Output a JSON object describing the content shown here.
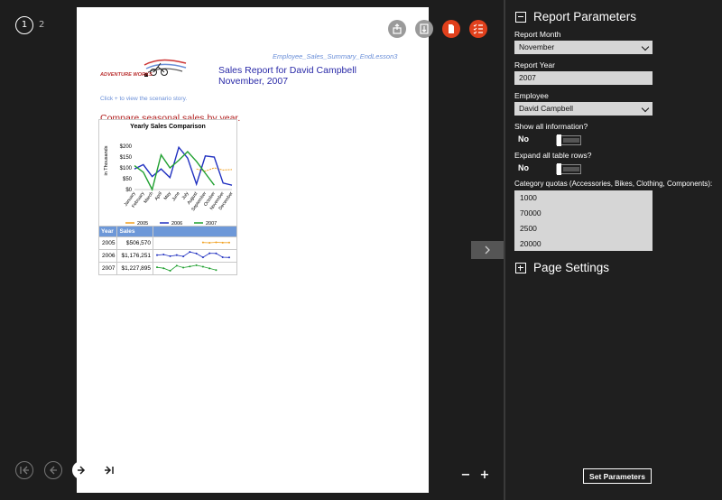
{
  "viewer": {
    "page_indicator": {
      "current": "1",
      "other": "2"
    },
    "zoom_out_label": "−",
    "zoom_in_label": "+",
    "next_page_icon": "chevron-right-icon",
    "nav_icons": [
      "first-page-icon",
      "previous-page-icon",
      "next-page-icon",
      "last-page-icon"
    ],
    "toolbar_icons": [
      "share-icon",
      "download-icon",
      "document-icon",
      "checklist-icon"
    ]
  },
  "report": {
    "filename": "Employee_Sales_Summary_EndLesson3",
    "title_line1": "Sales Report for David Campbell",
    "title_line2": "November, 2007",
    "logo_text": "ADVENTURE WORKS",
    "click_hint": "Click + to view the scenario story.",
    "compare_heading": "Compare seasonal sales by year.",
    "table": {
      "headers": [
        "Year",
        "Sales",
        ""
      ],
      "rows": [
        {
          "year": "2005",
          "sales": "$506,570"
        },
        {
          "year": "2006",
          "sales": "$1,176,251"
        },
        {
          "year": "2007",
          "sales": "$1,227,895"
        }
      ]
    }
  },
  "chart_data": {
    "type": "line",
    "title": "Yearly Sales Comparison",
    "ylabel": "in Thousands",
    "xlabel": "",
    "ylim": [
      0,
      200
    ],
    "yticks": [
      "$200",
      "$150",
      "$100",
      "$50",
      "$0"
    ],
    "categories": [
      "January",
      "February",
      "March",
      "April",
      "May",
      "June",
      "July",
      "August",
      "September",
      "October",
      "November",
      "December"
    ],
    "series": [
      {
        "name": "2005",
        "color": "#f0a020",
        "values": [
          null,
          null,
          null,
          null,
          null,
          null,
          null,
          95,
          85,
          100,
          90,
          92
        ]
      },
      {
        "name": "2006",
        "color": "#2030c0",
        "values": [
          95,
          115,
          60,
          95,
          55,
          195,
          145,
          25,
          155,
          150,
          30,
          20
        ]
      },
      {
        "name": "2007",
        "color": "#20a030",
        "values": [
          110,
          80,
          0,
          160,
          100,
          135,
          175,
          130,
          75,
          20,
          null,
          null
        ]
      }
    ],
    "legend_position": "bottom"
  },
  "sparklines": {
    "2005": [
      null,
      null,
      null,
      null,
      null,
      null,
      null,
      95,
      85,
      100,
      90,
      92
    ],
    "2006": [
      95,
      115,
      60,
      95,
      55,
      195,
      145,
      25,
      155,
      150,
      30,
      20
    ],
    "2007": [
      110,
      80,
      0,
      160,
      100,
      135,
      175,
      130,
      75,
      20,
      null,
      null
    ]
  },
  "panel": {
    "report_params_title": "Report Parameters",
    "report_month_label": "Report Month",
    "report_month_value": "November",
    "report_year_label": "Report Year",
    "report_year_value": "2007",
    "employee_label": "Employee",
    "employee_value": "David Campbell",
    "show_all_label": "Show all information?",
    "show_all_value": "No",
    "expand_rows_label": "Expand all table rows?",
    "expand_rows_value": "No",
    "quotas_label": "Category quotas (Accessories, Bikes, Clothing, Components):",
    "quotas": [
      "1000",
      "70000",
      "2500",
      "20000"
    ],
    "page_settings_title": "Page Settings",
    "set_params_label": "Set Parameters"
  }
}
